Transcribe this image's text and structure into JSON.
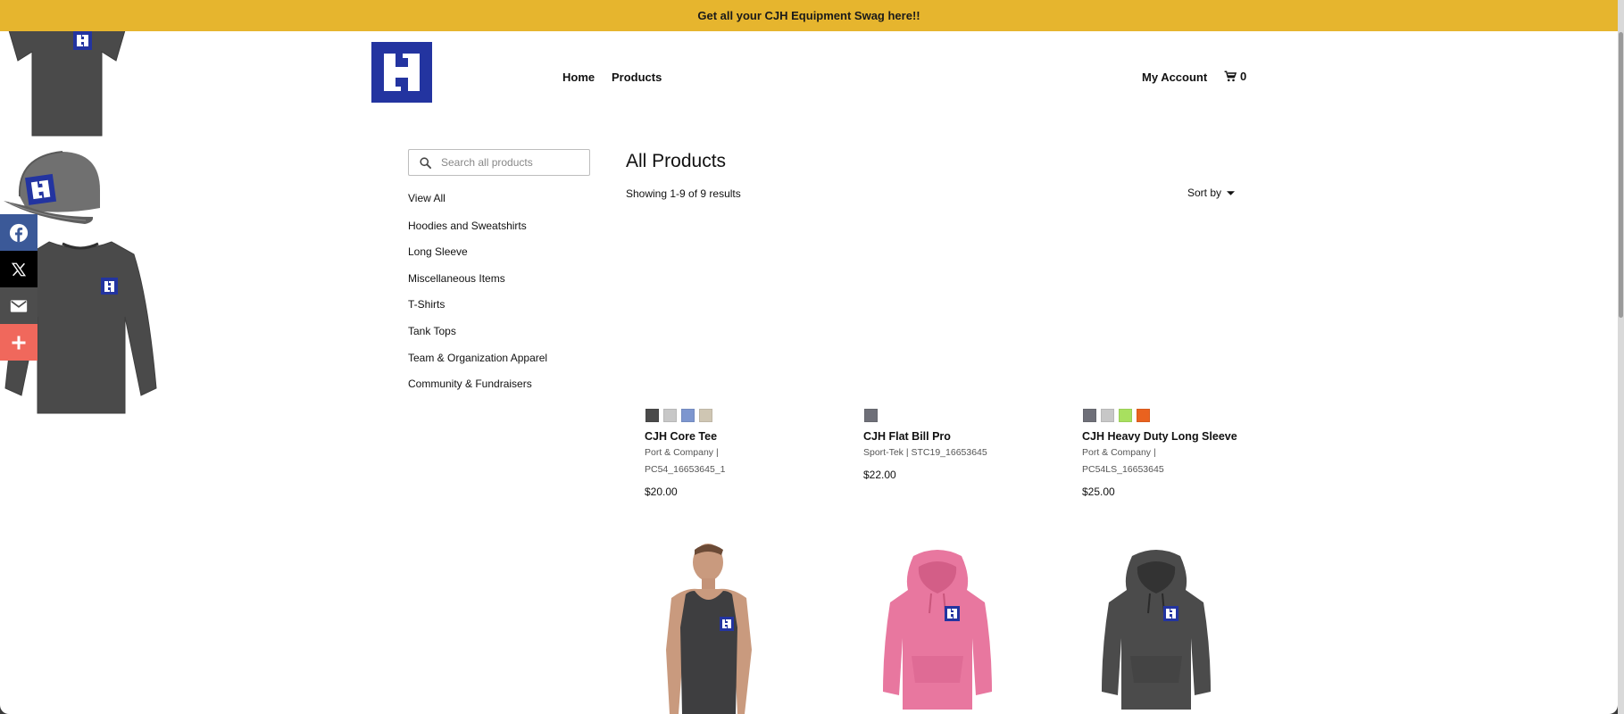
{
  "announcement": "Get all your CJH Equipment Swag here!!",
  "nav": {
    "home": "Home",
    "products": "Products",
    "account": "My Account",
    "cart_count": "0"
  },
  "search": {
    "placeholder": "Search all products"
  },
  "categories": [
    "View All",
    "Hoodies and Sweatshirts",
    "Long Sleeve",
    "Miscellaneous Items",
    "T-Shirts",
    "Tank Tops",
    "Team & Organization Apparel",
    "Community & Fundraisers"
  ],
  "main": {
    "title": "All Products",
    "results": "Showing 1-9 of 9 results",
    "sort_label": "Sort by"
  },
  "products": [
    {
      "name": "CJH Core Tee",
      "meta": "Port & Company | PC54_16653645_1",
      "price": "$20.00",
      "swatches": [
        "#4a4a4a",
        "#c7c7c7",
        "#7d96cf",
        "#cfc6b3"
      ]
    },
    {
      "name": "CJH Flat Bill Pro",
      "meta": "Sport-Tek | STC19_16653645",
      "price": "$22.00",
      "swatches": [
        "#6e6f78"
      ]
    },
    {
      "name": "CJH Heavy Duty Long Sleeve",
      "meta": "Port & Company | PC54LS_16653645",
      "price": "$25.00",
      "swatches": [
        "#6e6f78",
        "#c7c7c7",
        "#a8e05f",
        "#e9621f"
      ]
    }
  ],
  "social": [
    {
      "name": "facebook-icon",
      "color": "#3b5998"
    },
    {
      "name": "x-icon",
      "color": "#000000"
    },
    {
      "name": "email-icon",
      "color": "#4d4d4d"
    },
    {
      "name": "plus-icon",
      "color": "#f0685c"
    }
  ],
  "colors": {
    "announce_bg": "#e6b52e",
    "brand_blue": "#2334a0"
  }
}
